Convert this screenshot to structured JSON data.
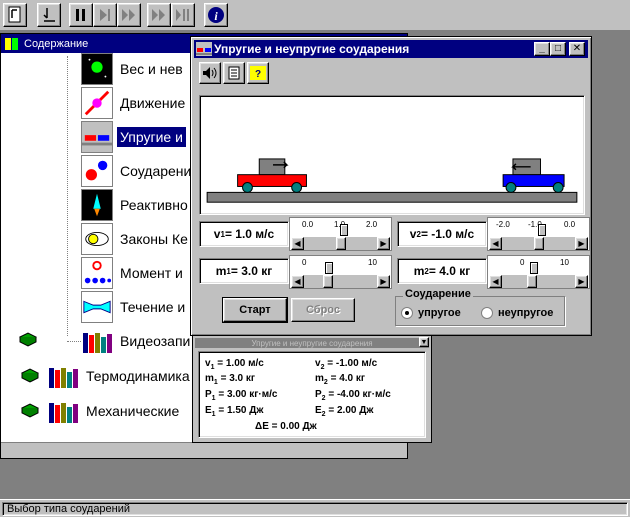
{
  "toolbar": {
    "buttons": [
      "book-icon",
      "exit-icon",
      "pause-icon",
      "step-forward-icon",
      "fast-forward-icon",
      "step-icon",
      "step-pause-icon",
      "info-icon"
    ]
  },
  "tree": {
    "title": "Содержание",
    "items": [
      {
        "label": "Вес и нев"
      },
      {
        "label": "Движение"
      },
      {
        "label": "Упругие и"
      },
      {
        "label": "Соударени"
      },
      {
        "label": "Реактивно"
      },
      {
        "label": "Законы Ке"
      },
      {
        "label": "Момент и"
      },
      {
        "label": "Течение и"
      },
      {
        "label": "Видеозапи"
      }
    ],
    "groups": [
      {
        "label": "Термодинамика"
      },
      {
        "label": "Механические"
      }
    ]
  },
  "dialog": {
    "title": "Упругие и неупругие соударения",
    "v1": {
      "label": "v",
      "sub": "1",
      "value": " = 1.0 м/с"
    },
    "v2": {
      "label": "v",
      "sub": "2",
      "value": " = -1.0 м/с"
    },
    "m1": {
      "label": "m",
      "sub": "1",
      "value": " = 3.0 кг"
    },
    "m2": {
      "label": "m",
      "sub": "2",
      "value": " = 4.0 кг"
    },
    "slider_v1": {
      "ticks": [
        "0.0",
        "1.0",
        "2.0"
      ],
      "level": 0.5
    },
    "slider_v2": {
      "ticks": [
        "-2.0",
        "-1.0",
        "0.0"
      ],
      "level": 0.5
    },
    "slider_m1": {
      "ticks": [
        "0",
        "10"
      ],
      "level": 0.3
    },
    "slider_m2": {
      "ticks": [
        "0",
        "10"
      ],
      "level": 0.4
    },
    "start_label": "Старт",
    "reset_label": "Сброс",
    "group_label": "Соударение",
    "radio_elastic": "упругое",
    "radio_inelastic": "неупругое",
    "colors": {
      "cart1": "#ff0000",
      "cart2": "#0000ff",
      "wheel": "#008080",
      "title": "#000080"
    }
  },
  "results": {
    "title": "Упругие и неупругие соударения",
    "rows": {
      "v1": {
        "l": "v",
        "s": "1",
        "v": " = 1.00 м/с"
      },
      "v2": {
        "l": "v",
        "s": "2",
        "v": " = -1.00 м/с"
      },
      "m1": {
        "l": "m",
        "s": "1",
        "v": " = 3.0 кг"
      },
      "m2": {
        "l": "m",
        "s": "2",
        "v": " = 4.0 кг"
      },
      "p1": {
        "l": "P",
        "s": "1",
        "v": " = 3.00 кг·м/с"
      },
      "p2": {
        "l": "P",
        "s": "2",
        "v": " = -4.00 кг·м/с"
      },
      "e1": {
        "l": "E",
        "s": "1",
        "v": " = 1.50 Дж"
      },
      "e2": {
        "l": "E",
        "s": "2",
        "v": " = 2.00 Дж"
      },
      "de": {
        "l": "ΔE",
        "v": " = 0.00 Дж"
      }
    }
  },
  "status": {
    "text": "Выбор типа соударений"
  }
}
